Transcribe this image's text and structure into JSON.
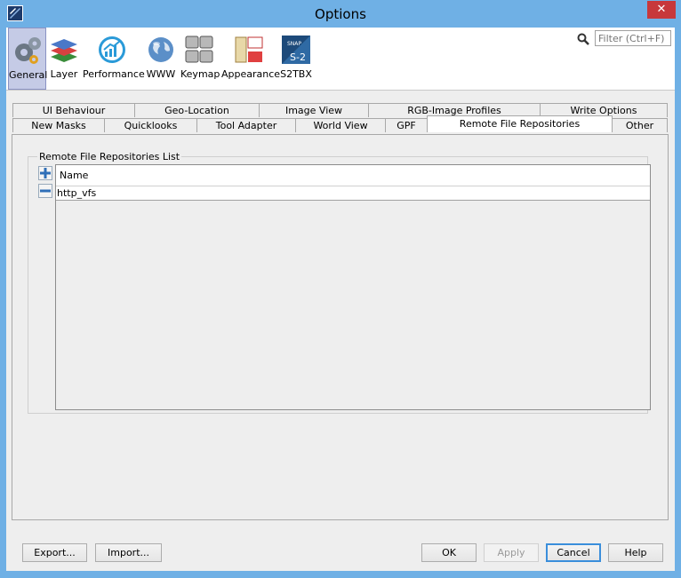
{
  "window": {
    "title": "Options",
    "close_label": "✕"
  },
  "filter": {
    "placeholder": "Filter (Ctrl+F)"
  },
  "categories": [
    {
      "label": "General",
      "icon": "gears-icon",
      "selected": true
    },
    {
      "label": "Layer",
      "icon": "layers-icon"
    },
    {
      "label": "Performance",
      "icon": "performance-chart-icon"
    },
    {
      "label": "WWW",
      "icon": "globe-icon"
    },
    {
      "label": "Keymap",
      "icon": "keyboard-icon"
    },
    {
      "label": "Appearance",
      "icon": "appearance-icon"
    },
    {
      "label": "S2TBX",
      "icon": "snap-s2-icon"
    }
  ],
  "tabs_row1": [
    "UI Behaviour",
    "Geo-Location",
    "Image View",
    "RGB-Image Profiles",
    "Write Options"
  ],
  "tabs_row2": [
    "New Masks",
    "Quicklooks",
    "Tool Adapter",
    "World View",
    "GPF",
    "Remote File Repositories",
    "Other"
  ],
  "selected_tab": "Remote File Repositories",
  "panel": {
    "group_title": "Remote File Repositories List",
    "column_header": "Name",
    "rows": [
      "http_vfs"
    ]
  },
  "buttons": {
    "export": "Export...",
    "import": "Import...",
    "ok": "OK",
    "apply": "Apply",
    "cancel": "Cancel",
    "help": "Help"
  },
  "colors": {
    "title_bar": "#6fb0e5",
    "close_button": "#c7383b",
    "selection": "#c5cbe6"
  }
}
